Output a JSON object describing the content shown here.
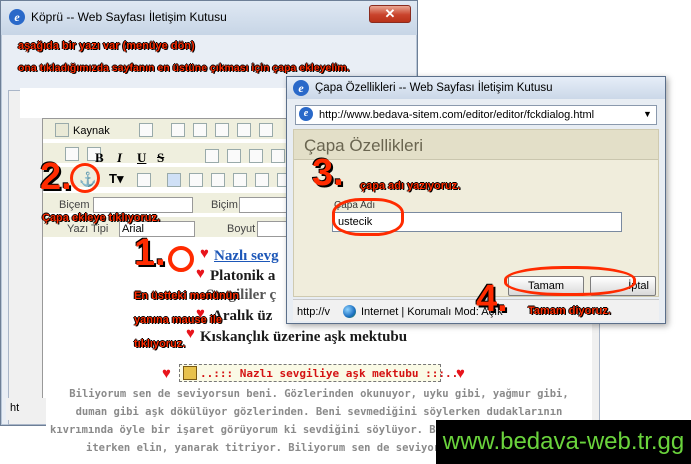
{
  "window1": {
    "title": "Köprü -- Web Sayfası İletişim Kutusu",
    "close_glyph": "✕"
  },
  "annotation_top": {
    "line1": "aşağıda bir yazı var  (menüye dön)",
    "line2": "ona tıkladığımızda sayfanın en üstüne çıkması için çapa ekleyelim."
  },
  "editor": {
    "source_label": "Kaynak",
    "format_label": "Biçem",
    "format2_label": "Biçim",
    "font_label": "Yazı Tipi",
    "font_value": "Arial",
    "size_label": "Boyut",
    "bold": "B",
    "italic": "I",
    "underline": "U",
    "strike": "S"
  },
  "content": {
    "link_text": "Nazlı sevg",
    "line2": "Platonik a",
    "line3": "Sevgililer ç",
    "line4": "Aralık üz",
    "line5": "Kıskançlık üzerine aşk mektubu",
    "banner": "..::: Nazlı sevgiliye aşk mektubu :::..",
    "para1": "Biliyorum sen de seviyorsun beni. Gözlerinden okunuyor, uyku gibi, yağmur gibi,",
    "para2": "duman gibi aşk dökülüyor gözlerinden. Beni sevmediğini söylerken dudaklarının",
    "para3": "kıvrımında öyle bir işaret görüyorum ki sevdiğini söylüyor. B",
    "para4": "iterken elin, yanarak titriyor. Biliyorum sen de seviyorsun",
    "status_left": "ht"
  },
  "window2": {
    "title": "Çapa Özellikleri -- Web Sayfası İletişim Kutusu",
    "url": "http://www.bedava-sitem.com/editor/editor/fckdialog.html",
    "dialog_title": "Çapa Özellikleri",
    "field_label": "Çapa Adı",
    "field_value": "ustecik",
    "ok_label": "Tamam",
    "cancel_label": "İptal",
    "status_url": "http://v",
    "status_zone": "Internet | Korumalı Mod: Açık"
  },
  "steps": {
    "n1": "1.",
    "n2": "2.",
    "n3": "3.",
    "n4": "4.",
    "step1_text_a": "En üstteki menünün",
    "step1_text_b": "yanına mause ile",
    "step1_text_c": "tıklıyoruz.",
    "step2_text": "Çapa ekleye tıklıyoruz.",
    "step3_text": "çapa adı yazıyoruz.",
    "step4_text": "Tamam diyoruz."
  },
  "watermark": "www.bedava-web.tr.gg",
  "colors": {
    "annotation": "#ff2b00",
    "watermark_text": "#6ad33c",
    "heart": "#e8141c"
  }
}
